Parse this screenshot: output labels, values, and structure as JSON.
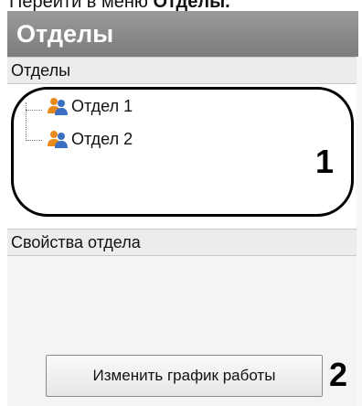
{
  "menu_hint": {
    "prefix": "Перейти в меню ",
    "bold": "Отделы."
  },
  "panel": {
    "title": "Отделы"
  },
  "departments_section": {
    "header": "Отделы",
    "items": [
      {
        "label": "Отдел 1",
        "icon": "users-icon"
      },
      {
        "label": "Отдел 2",
        "icon": "users-icon"
      }
    ]
  },
  "properties_section": {
    "header": "Свойства отдела"
  },
  "buttons": {
    "change_schedule": "Изменить график работы"
  },
  "callouts": {
    "one": "1",
    "two": "2"
  },
  "colors": {
    "title_bar": "#8a8a8a",
    "icon_orange": "#e88a1a",
    "icon_blue": "#3a6fc4"
  }
}
